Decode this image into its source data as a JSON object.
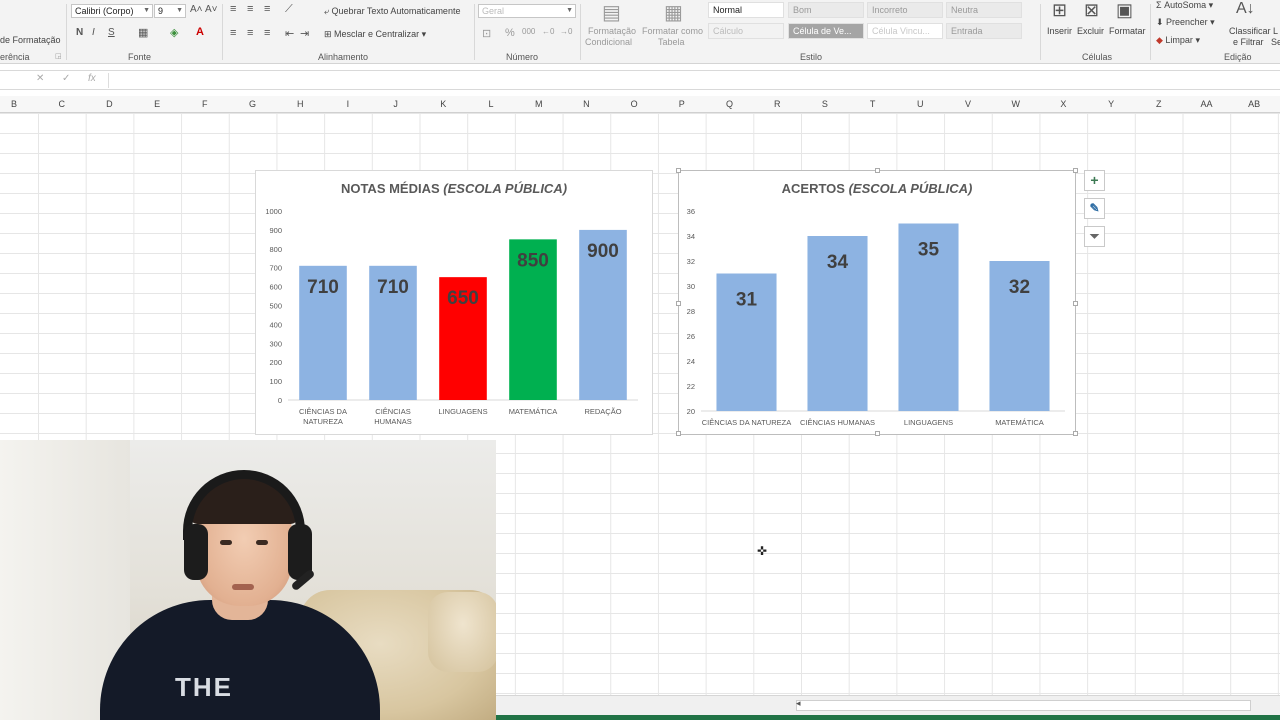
{
  "ribbon": {
    "clipboard_label": "de Formatação",
    "clipboard_group": "erência",
    "font_name": "Calibri (Corpo)",
    "font_size": "9",
    "font_group": "Fonte",
    "bold": "N",
    "italic": "I",
    "underline": "S",
    "wrap_text": "Quebrar Texto Automaticamente",
    "merge_center": "Mesclar e Centralizar",
    "alignment_group": "Alinhamento",
    "number_format": "Geral",
    "number_group": "Número",
    "cond_format_1": "Formatação",
    "cond_format_2": "Condicional",
    "format_table_1": "Formatar como",
    "format_table_2": "Tabela",
    "styles": {
      "normal": "Normal",
      "bom": "Bom",
      "incorreto": "Incorreto",
      "neutra": "Neutra",
      "calculo": "Cálculo",
      "celula_verif": "Célula de Ve...",
      "celula_vinc": "Célula Vincu...",
      "entrada": "Entrada"
    },
    "style_group": "Estilo",
    "insert": "Inserir",
    "delete": "Excluir",
    "format": "Formatar",
    "cells_group": "Células",
    "autosum": "AutoSoma",
    "fill": "Preencher",
    "clear": "Limpar",
    "sort_filter_1": "Classificar",
    "sort_filter_2": "e Filtrar",
    "find_1": "L",
    "find_2": "Se",
    "editing_group": "Edição"
  },
  "formula_bar": {
    "fx": "fx"
  },
  "columns": [
    "B",
    "C",
    "D",
    "E",
    "F",
    "G",
    "H",
    "I",
    "J",
    "K",
    "L",
    "M",
    "N",
    "O",
    "P",
    "Q",
    "R",
    "S",
    "T",
    "U",
    "V",
    "W",
    "X",
    "Y",
    "Z",
    "AA",
    "AB"
  ],
  "chart_data": [
    {
      "type": "bar",
      "title_main": "NOTAS MÉDIAS",
      "title_italic": "(ESCOLA PÚBLICA)",
      "categories": [
        "CIÊNCIAS DA NATUREZA",
        "CIÊNCIAS HUMANAS",
        "LINGUAGENS",
        "MATEMÁTICA",
        "REDAÇÃO"
      ],
      "category_lines": [
        [
          "CIÊNCIAS DA",
          "NATUREZA"
        ],
        [
          "CIÊNCIAS",
          "HUMANAS"
        ],
        [
          "LINGUAGENS"
        ],
        [
          "MATEMÁTICA"
        ],
        [
          "REDAÇÃO"
        ]
      ],
      "values": [
        710,
        710,
        650,
        850,
        900
      ],
      "bar_colors": [
        "#8db3e2",
        "#8db3e2",
        "#ff0000",
        "#00b050",
        "#8db3e2"
      ],
      "ylim": [
        0,
        1000
      ],
      "yticks": [
        0,
        100,
        200,
        300,
        400,
        500,
        600,
        700,
        800,
        900,
        1000
      ],
      "grid": false
    },
    {
      "type": "bar",
      "title_main": "ACERTOS",
      "title_italic": "(ESCOLA PÚBLICA)",
      "categories": [
        "CIÊNCIAS DA NATUREZA",
        "CIÊNCIAS HUMANAS",
        "LINGUAGENS",
        "MATEMÁTICA"
      ],
      "category_lines": [
        [
          "CIÊNCIAS DA NATUREZA"
        ],
        [
          "CIÊNCIAS HUMANAS"
        ],
        [
          "LINGUAGENS"
        ],
        [
          "MATEMÁTICA"
        ]
      ],
      "values": [
        31,
        34,
        35,
        32
      ],
      "bar_colors": [
        "#8db3e2",
        "#8db3e2",
        "#8db3e2",
        "#8db3e2"
      ],
      "ylim": [
        20,
        36
      ],
      "yticks": [
        20,
        22,
        24,
        26,
        28,
        30,
        32,
        34,
        36
      ],
      "grid": false
    }
  ],
  "chart_buttons": {
    "add": "+",
    "style": "✎",
    "filter": "⏷"
  },
  "webcam": {
    "shirt_text": "THE"
  }
}
